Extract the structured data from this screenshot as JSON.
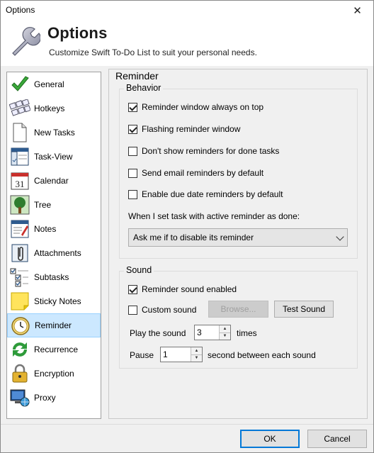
{
  "window": {
    "title": "Options",
    "close_glyph": "✕"
  },
  "header": {
    "title": "Options",
    "subtitle": "Customize Swift To-Do List to suit your personal needs.",
    "icon": "wrench-icon"
  },
  "nav": {
    "items": [
      {
        "label": "General",
        "icon": "checkmark-icon"
      },
      {
        "label": "Hotkeys",
        "icon": "keyboard-icon"
      },
      {
        "label": "New Tasks",
        "icon": "new-document-icon"
      },
      {
        "label": "Task-View",
        "icon": "task-view-icon"
      },
      {
        "label": "Calendar",
        "icon": "calendar-icon",
        "day": "31"
      },
      {
        "label": "Tree",
        "icon": "tree-icon"
      },
      {
        "label": "Notes",
        "icon": "notes-icon"
      },
      {
        "label": "Attachments",
        "icon": "paperclip-icon"
      },
      {
        "label": "Subtasks",
        "icon": "subtasks-icon"
      },
      {
        "label": "Sticky Notes",
        "icon": "sticky-note-icon"
      },
      {
        "label": "Reminder",
        "icon": "alarm-clock-icon",
        "selected": true
      },
      {
        "label": "Recurrence",
        "icon": "recurrence-arrows-icon"
      },
      {
        "label": "Encryption",
        "icon": "padlock-icon"
      },
      {
        "label": "Proxy",
        "icon": "network-globe-icon"
      }
    ]
  },
  "panel": {
    "title": "Reminder",
    "behavior": {
      "legend": "Behavior",
      "options": [
        {
          "label": "Reminder window always on top",
          "checked": true
        },
        {
          "label": "Flashing reminder window",
          "checked": true
        },
        {
          "label": "Don't show reminders for done tasks",
          "checked": false
        },
        {
          "label": "Send email reminders by default",
          "checked": false
        },
        {
          "label": "Enable due date reminders by default",
          "checked": false
        }
      ],
      "done_label": "When I set task with active reminder as done:",
      "done_value": "Ask me if to disable its reminder"
    },
    "sound": {
      "legend": "Sound",
      "enabled_label": "Reminder sound enabled",
      "enabled_checked": true,
      "custom_label": "Custom sound",
      "custom_checked": false,
      "browse_label": "Browse...",
      "test_label": "Test Sound",
      "play_label": "Play the sound",
      "play_value": "3",
      "times_label": "times",
      "pause_label": "Pause",
      "pause_value": "1",
      "pause_suffix": "second between each sound"
    }
  },
  "footer": {
    "ok_label": "OK",
    "cancel_label": "Cancel"
  },
  "colors": {
    "selection": "#cce8ff",
    "selection_border": "#99d1ff",
    "focus_border": "#0078d7",
    "dialog_bg": "#f0f0f0"
  }
}
